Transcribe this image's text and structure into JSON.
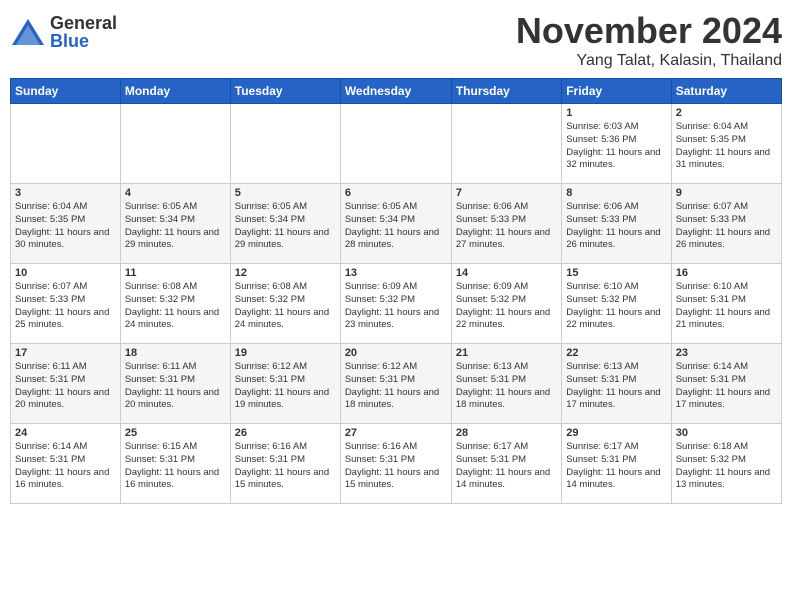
{
  "header": {
    "logo_general": "General",
    "logo_blue": "Blue",
    "month_title": "November 2024",
    "location": "Yang Talat, Kalasin, Thailand"
  },
  "calendar": {
    "days_of_week": [
      "Sunday",
      "Monday",
      "Tuesday",
      "Wednesday",
      "Thursday",
      "Friday",
      "Saturday"
    ],
    "weeks": [
      [
        {
          "day": "",
          "info": ""
        },
        {
          "day": "",
          "info": ""
        },
        {
          "day": "",
          "info": ""
        },
        {
          "day": "",
          "info": ""
        },
        {
          "day": "",
          "info": ""
        },
        {
          "day": "1",
          "info": "Sunrise: 6:03 AM\nSunset: 5:36 PM\nDaylight: 11 hours and 32 minutes."
        },
        {
          "day": "2",
          "info": "Sunrise: 6:04 AM\nSunset: 5:35 PM\nDaylight: 11 hours and 31 minutes."
        }
      ],
      [
        {
          "day": "3",
          "info": "Sunrise: 6:04 AM\nSunset: 5:35 PM\nDaylight: 11 hours and 30 minutes."
        },
        {
          "day": "4",
          "info": "Sunrise: 6:05 AM\nSunset: 5:34 PM\nDaylight: 11 hours and 29 minutes."
        },
        {
          "day": "5",
          "info": "Sunrise: 6:05 AM\nSunset: 5:34 PM\nDaylight: 11 hours and 29 minutes."
        },
        {
          "day": "6",
          "info": "Sunrise: 6:05 AM\nSunset: 5:34 PM\nDaylight: 11 hours and 28 minutes."
        },
        {
          "day": "7",
          "info": "Sunrise: 6:06 AM\nSunset: 5:33 PM\nDaylight: 11 hours and 27 minutes."
        },
        {
          "day": "8",
          "info": "Sunrise: 6:06 AM\nSunset: 5:33 PM\nDaylight: 11 hours and 26 minutes."
        },
        {
          "day": "9",
          "info": "Sunrise: 6:07 AM\nSunset: 5:33 PM\nDaylight: 11 hours and 26 minutes."
        }
      ],
      [
        {
          "day": "10",
          "info": "Sunrise: 6:07 AM\nSunset: 5:33 PM\nDaylight: 11 hours and 25 minutes."
        },
        {
          "day": "11",
          "info": "Sunrise: 6:08 AM\nSunset: 5:32 PM\nDaylight: 11 hours and 24 minutes."
        },
        {
          "day": "12",
          "info": "Sunrise: 6:08 AM\nSunset: 5:32 PM\nDaylight: 11 hours and 24 minutes."
        },
        {
          "day": "13",
          "info": "Sunrise: 6:09 AM\nSunset: 5:32 PM\nDaylight: 11 hours and 23 minutes."
        },
        {
          "day": "14",
          "info": "Sunrise: 6:09 AM\nSunset: 5:32 PM\nDaylight: 11 hours and 22 minutes."
        },
        {
          "day": "15",
          "info": "Sunrise: 6:10 AM\nSunset: 5:32 PM\nDaylight: 11 hours and 22 minutes."
        },
        {
          "day": "16",
          "info": "Sunrise: 6:10 AM\nSunset: 5:31 PM\nDaylight: 11 hours and 21 minutes."
        }
      ],
      [
        {
          "day": "17",
          "info": "Sunrise: 6:11 AM\nSunset: 5:31 PM\nDaylight: 11 hours and 20 minutes."
        },
        {
          "day": "18",
          "info": "Sunrise: 6:11 AM\nSunset: 5:31 PM\nDaylight: 11 hours and 20 minutes."
        },
        {
          "day": "19",
          "info": "Sunrise: 6:12 AM\nSunset: 5:31 PM\nDaylight: 11 hours and 19 minutes."
        },
        {
          "day": "20",
          "info": "Sunrise: 6:12 AM\nSunset: 5:31 PM\nDaylight: 11 hours and 18 minutes."
        },
        {
          "day": "21",
          "info": "Sunrise: 6:13 AM\nSunset: 5:31 PM\nDaylight: 11 hours and 18 minutes."
        },
        {
          "day": "22",
          "info": "Sunrise: 6:13 AM\nSunset: 5:31 PM\nDaylight: 11 hours and 17 minutes."
        },
        {
          "day": "23",
          "info": "Sunrise: 6:14 AM\nSunset: 5:31 PM\nDaylight: 11 hours and 17 minutes."
        }
      ],
      [
        {
          "day": "24",
          "info": "Sunrise: 6:14 AM\nSunset: 5:31 PM\nDaylight: 11 hours and 16 minutes."
        },
        {
          "day": "25",
          "info": "Sunrise: 6:15 AM\nSunset: 5:31 PM\nDaylight: 11 hours and 16 minutes."
        },
        {
          "day": "26",
          "info": "Sunrise: 6:16 AM\nSunset: 5:31 PM\nDaylight: 11 hours and 15 minutes."
        },
        {
          "day": "27",
          "info": "Sunrise: 6:16 AM\nSunset: 5:31 PM\nDaylight: 11 hours and 15 minutes."
        },
        {
          "day": "28",
          "info": "Sunrise: 6:17 AM\nSunset: 5:31 PM\nDaylight: 11 hours and 14 minutes."
        },
        {
          "day": "29",
          "info": "Sunrise: 6:17 AM\nSunset: 5:31 PM\nDaylight: 11 hours and 14 minutes."
        },
        {
          "day": "30",
          "info": "Sunrise: 6:18 AM\nSunset: 5:32 PM\nDaylight: 11 hours and 13 minutes."
        }
      ]
    ]
  }
}
